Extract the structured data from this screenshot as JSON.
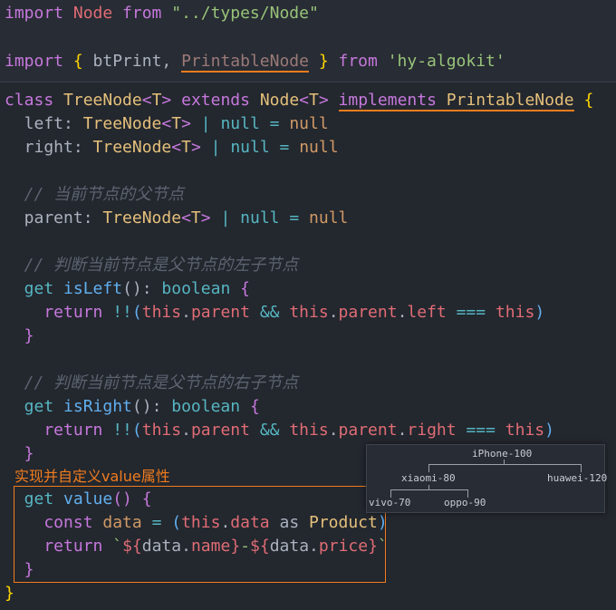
{
  "top_lines": [
    [
      [
        "import ",
        "kw"
      ],
      [
        "Node ",
        "red"
      ],
      [
        "from ",
        "kw"
      ],
      [
        "\"../types/Node\"",
        "str"
      ]
    ],
    [],
    [
      [
        "import ",
        "kw"
      ],
      [
        "{ ",
        "yb"
      ],
      [
        "btPrint, ",
        "pl"
      ],
      [
        "PrintableNode",
        "dim ul"
      ],
      [
        " } ",
        "yb"
      ],
      [
        "from ",
        "kw"
      ],
      [
        "'hy-algokit'",
        "str"
      ]
    ]
  ],
  "code_lines": [
    [
      [
        "class ",
        "kw"
      ],
      [
        "TreeNode",
        "ty"
      ],
      [
        "<",
        "pu"
      ],
      [
        "T",
        "ty"
      ],
      [
        "> ",
        "pu"
      ],
      [
        "extends ",
        "kw"
      ],
      [
        "Node",
        "ty"
      ],
      [
        "<",
        "pu"
      ],
      [
        "T",
        "ty"
      ],
      [
        "> ",
        "pu"
      ],
      [
        "implements ",
        "kw ul"
      ],
      [
        "PrintableNode",
        "ty ul"
      ],
      [
        " {",
        "yb"
      ]
    ],
    [
      [
        "  left: ",
        "pl"
      ],
      [
        "TreeNode",
        "ty"
      ],
      [
        "<",
        "pu"
      ],
      [
        "T",
        "ty"
      ],
      [
        "> ",
        "pu"
      ],
      [
        "| ",
        "cy"
      ],
      [
        "null ",
        "cy"
      ],
      [
        "= ",
        "cy"
      ],
      [
        "null",
        "num"
      ]
    ],
    [
      [
        "  right: ",
        "pl"
      ],
      [
        "TreeNode",
        "ty"
      ],
      [
        "<",
        "pu"
      ],
      [
        "T",
        "ty"
      ],
      [
        "> ",
        "pu"
      ],
      [
        "| ",
        "cy"
      ],
      [
        "null ",
        "cy"
      ],
      [
        "= ",
        "cy"
      ],
      [
        "null",
        "num"
      ]
    ],
    [],
    [
      [
        "  // 当前节点的父节点",
        "cm"
      ]
    ],
    [
      [
        "  parent: ",
        "pl"
      ],
      [
        "TreeNode",
        "ty"
      ],
      [
        "<",
        "pu"
      ],
      [
        "T",
        "ty"
      ],
      [
        "> ",
        "pu"
      ],
      [
        "| ",
        "cy"
      ],
      [
        "null ",
        "cy"
      ],
      [
        "= ",
        "cy"
      ],
      [
        "null",
        "num"
      ]
    ],
    [],
    [
      [
        "  // 判断当前节点是父节点的左子节点",
        "cm"
      ]
    ],
    [
      [
        "  get ",
        "cy"
      ],
      [
        "isLeft",
        "fn"
      ],
      [
        "(): ",
        "pl"
      ],
      [
        "boolean ",
        "cy"
      ],
      [
        "{",
        "pu"
      ]
    ],
    [
      [
        "    return ",
        "kw"
      ],
      [
        "!!",
        "cy"
      ],
      [
        "(",
        "fn"
      ],
      [
        "this",
        "red"
      ],
      [
        ".",
        "pl"
      ],
      [
        "parent ",
        "red"
      ],
      [
        "&& ",
        "cy"
      ],
      [
        "this",
        "red"
      ],
      [
        ".",
        "pl"
      ],
      [
        "parent",
        "red"
      ],
      [
        ".",
        "pl"
      ],
      [
        "left ",
        "red"
      ],
      [
        "=== ",
        "cy"
      ],
      [
        "this",
        "red"
      ],
      [
        ")",
        "fn"
      ]
    ],
    [
      [
        "  }",
        "pu"
      ]
    ],
    [],
    [
      [
        "  // 判断当前节点是父节点的右子节点",
        "cm"
      ]
    ],
    [
      [
        "  get ",
        "cy"
      ],
      [
        "isRight",
        "fn"
      ],
      [
        "(): ",
        "pl"
      ],
      [
        "boolean ",
        "cy"
      ],
      [
        "{",
        "pu"
      ]
    ],
    [
      [
        "    return ",
        "kw"
      ],
      [
        "!!",
        "cy"
      ],
      [
        "(",
        "fn"
      ],
      [
        "this",
        "red"
      ],
      [
        ".",
        "pl"
      ],
      [
        "parent ",
        "red"
      ],
      [
        "&& ",
        "cy"
      ],
      [
        "this",
        "red"
      ],
      [
        ".",
        "pl"
      ],
      [
        "parent",
        "red"
      ],
      [
        ".",
        "pl"
      ],
      [
        "right ",
        "red"
      ],
      [
        "=== ",
        "cy"
      ],
      [
        "this",
        "red"
      ],
      [
        ")",
        "fn"
      ]
    ],
    [
      [
        "  }",
        "pu"
      ]
    ]
  ],
  "annotation": "实现并自定义value属性",
  "value_lines": [
    [
      [
        "  get ",
        "cy"
      ],
      [
        "value",
        "fn"
      ],
      [
        "() ",
        "pu"
      ],
      [
        "{",
        "pu"
      ]
    ],
    [
      [
        "    const ",
        "kw"
      ],
      [
        "data ",
        "num"
      ],
      [
        "= ",
        "cy"
      ],
      [
        "(",
        "fn"
      ],
      [
        "this",
        "red"
      ],
      [
        ".",
        "pl"
      ],
      [
        "data ",
        "red"
      ],
      [
        "as ",
        "pl"
      ],
      [
        "Product",
        "ty"
      ],
      [
        ")",
        "fn"
      ]
    ],
    [
      [
        "    return ",
        "kw"
      ],
      [
        "`",
        "str"
      ],
      [
        "${",
        "red"
      ],
      [
        "data",
        "pl"
      ],
      [
        ".",
        "pl"
      ],
      [
        "name",
        "red"
      ],
      [
        "}",
        "red"
      ],
      [
        "-",
        "str"
      ],
      [
        "${",
        "red"
      ],
      [
        "data",
        "pl"
      ],
      [
        ".",
        "pl"
      ],
      [
        "price",
        "red"
      ],
      [
        "}",
        "red"
      ],
      [
        "`",
        "str"
      ]
    ],
    [
      [
        "  }",
        "pu"
      ]
    ],
    [
      [
        "}",
        "yb"
      ]
    ]
  ],
  "tree_popup": {
    "root": "iPhone-100",
    "left": "xiaomi-80",
    "right": "huawei-120",
    "left_left": "vivo-70",
    "left_right": "oppo-90"
  }
}
